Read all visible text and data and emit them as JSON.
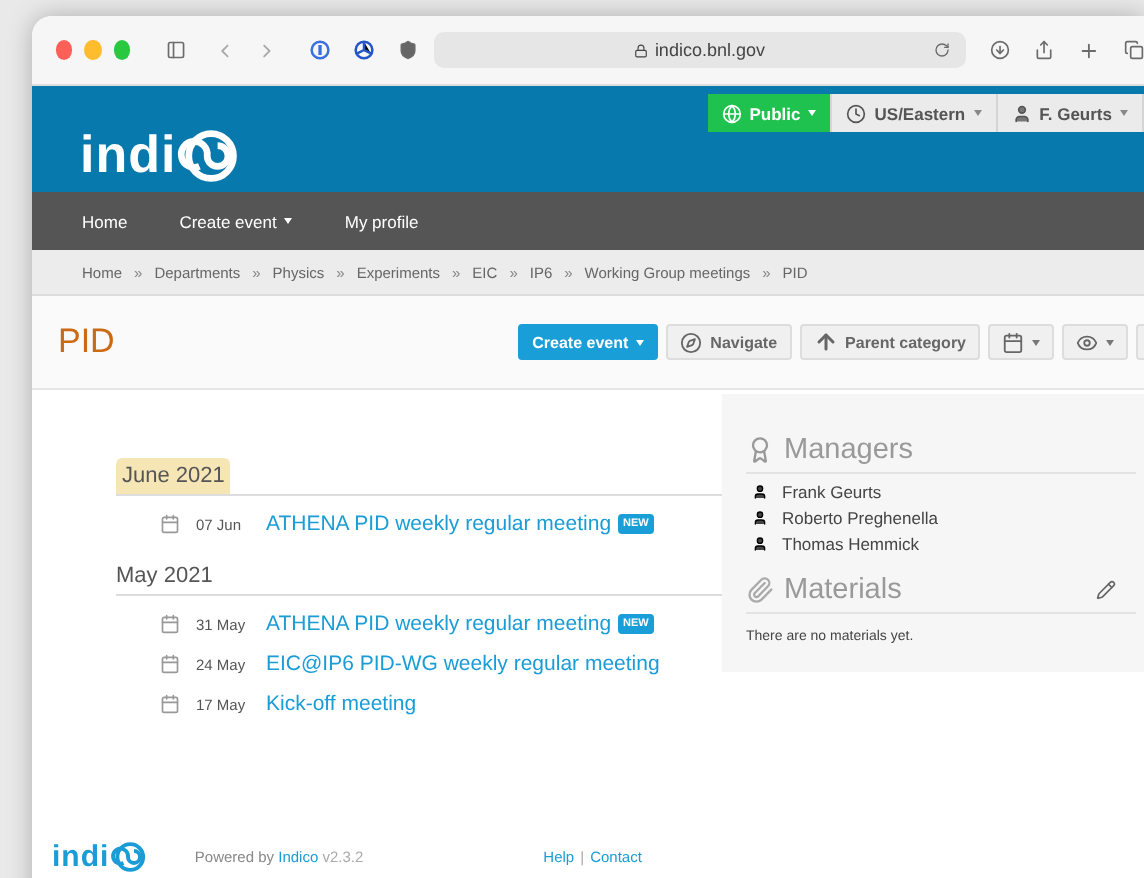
{
  "browser": {
    "url": "indico.bnl.gov"
  },
  "header": {
    "logo": "indi",
    "buttons": [
      {
        "kind": "protection",
        "label": "Public"
      },
      {
        "kind": "timezone",
        "label": "US/Eastern"
      },
      {
        "kind": "user",
        "label": "F. Geurts"
      }
    ]
  },
  "nav": [
    {
      "label": "Home",
      "dropdown": false
    },
    {
      "label": "Create event",
      "dropdown": true
    },
    {
      "label": "My profile",
      "dropdown": false
    }
  ],
  "breadcrumb": {
    "separator": "»",
    "items": [
      "Home",
      "Departments",
      "Physics",
      "Experiments",
      "EIC",
      "IP6",
      "Working Group meetings",
      "PID"
    ]
  },
  "category": {
    "title": "PID"
  },
  "toolbar": [
    {
      "kind": "primary",
      "label": "Create event"
    },
    {
      "kind": "navigate",
      "label": "Navigate"
    },
    {
      "kind": "parent",
      "label": "Parent category"
    },
    {
      "kind": "calendar"
    },
    {
      "kind": "view"
    }
  ],
  "months": [
    {
      "label": "June 2021",
      "current": true,
      "events": [
        {
          "date": "07 Jun",
          "title": "ATHENA PID weekly regular meeting",
          "badge": "NEW"
        }
      ]
    },
    {
      "label": "May 2021",
      "current": false,
      "events": [
        {
          "date": "31 May",
          "title": "ATHENA PID weekly regular meeting",
          "badge": "NEW"
        },
        {
          "date": "24 May",
          "title": "EIC@IP6 PID-WG weekly regular meeting"
        },
        {
          "date": "17 May",
          "title": "Kick-off meeting"
        }
      ]
    }
  ],
  "managers": {
    "title": "Managers",
    "people": [
      "Frank Geurts",
      "Roberto Preghenella",
      "Thomas Hemmick"
    ]
  },
  "materials": {
    "title": "Materials",
    "empty": "There are no materials yet."
  },
  "footer": {
    "logo": "indi",
    "powered": "Powered by",
    "link": "Indico",
    "version": "v2.3.2",
    "links": [
      "Help",
      "Contact"
    ],
    "separator": "|"
  }
}
